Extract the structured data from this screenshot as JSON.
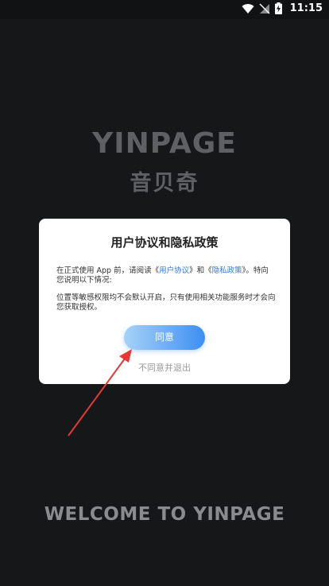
{
  "status_bar": {
    "time": "11:15"
  },
  "brand": {
    "name_en": "YINPAGE",
    "name_cn": "音贝奇"
  },
  "dialog": {
    "title": "用户协议和隐私政策",
    "para1_prefix": "在正式使用 App 前，请阅读《",
    "user_agreement_link": "用户协议",
    "para1_middle": "》和《",
    "privacy_policy_link": "隐私政策",
    "para1_suffix": "》。特向您说明以下情况:",
    "para2": "位置等敏感权限均不会默认开启，只有使用相关功能服务时才会向您获取授权。",
    "agree_label": "同意",
    "disagree_label": "不同意并退出"
  },
  "welcome_text": "WELCOME TO YINPAGE",
  "colors": {
    "background": "#161719",
    "brand_text": "#5f6064",
    "link": "#2f78e6",
    "button_start": "#a7d2f7",
    "button_end": "#3d8ef3",
    "arrow": "#e53935"
  }
}
